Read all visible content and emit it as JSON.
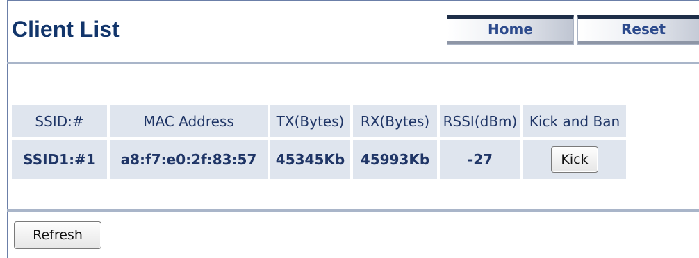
{
  "header": {
    "title": "Client List",
    "home_label": "Home",
    "reset_label": "Reset"
  },
  "table": {
    "columns": [
      "SSID:#",
      "MAC Address",
      "TX(Bytes)",
      "RX(Bytes)",
      "RSSI(dBm)",
      "Kick and Ban"
    ],
    "rows": [
      {
        "ssid": "SSID1:#1",
        "mac": "a8:f7:e0:2f:83:57",
        "tx": "45345Kb",
        "rx": "45993Kb",
        "rssi": "-27",
        "kick_label": "Kick"
      }
    ]
  },
  "footer": {
    "refresh_label": "Refresh"
  },
  "colors": {
    "title": "#12356b",
    "cell_background": "#dfe5ee",
    "rule": "#a9b5c9",
    "button_text": "#2c4a8c"
  }
}
